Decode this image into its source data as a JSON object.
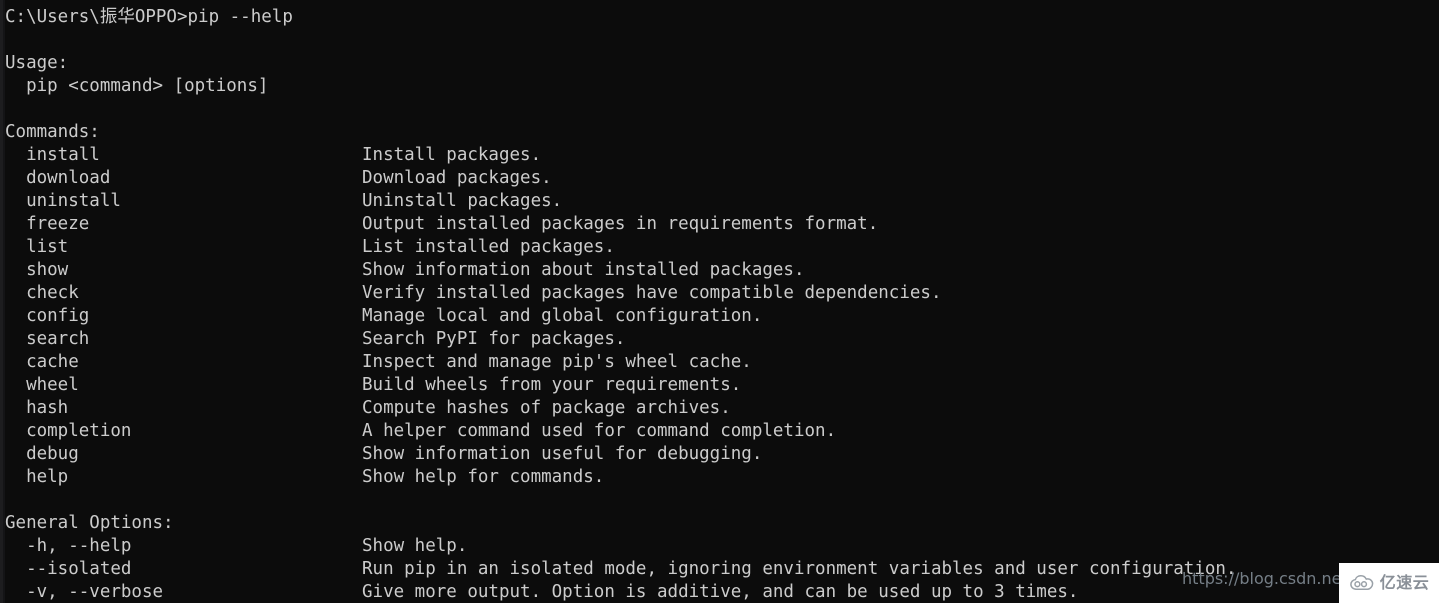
{
  "terminal": {
    "background_color": "#0c0c0c",
    "text_color": "#cccccc",
    "prompt_line": "C:\\Users\\振华OPPO>pip --help",
    "usage_header": "Usage:",
    "usage_line": "  pip <command> [options]",
    "commands_header": "Commands:",
    "commands": [
      {
        "name": "  install",
        "description": "Install packages."
      },
      {
        "name": "  download",
        "description": "Download packages."
      },
      {
        "name": "  uninstall",
        "description": "Uninstall packages."
      },
      {
        "name": "  freeze",
        "description": "Output installed packages in requirements format."
      },
      {
        "name": "  list",
        "description": "List installed packages."
      },
      {
        "name": "  show",
        "description": "Show information about installed packages."
      },
      {
        "name": "  check",
        "description": "Verify installed packages have compatible dependencies."
      },
      {
        "name": "  config",
        "description": "Manage local and global configuration."
      },
      {
        "name": "  search",
        "description": "Search PyPI for packages."
      },
      {
        "name": "  cache",
        "description": "Inspect and manage pip's wheel cache."
      },
      {
        "name": "  wheel",
        "description": "Build wheels from your requirements."
      },
      {
        "name": "  hash",
        "description": "Compute hashes of package archives."
      },
      {
        "name": "  completion",
        "description": "A helper command used for command completion."
      },
      {
        "name": "  debug",
        "description": "Show information useful for debugging."
      },
      {
        "name": "  help",
        "description": "Show help for commands."
      }
    ],
    "general_options_header": "General Options:",
    "general_options": [
      {
        "name": "  -h, --help",
        "description": "Show help."
      },
      {
        "name": "  --isolated",
        "description": "Run pip in an isolated mode, ignoring environment variables and user configuration."
      },
      {
        "name": "  -v, --verbose",
        "description": "Give more output. Option is additive, and can be used up to 3 times."
      }
    ]
  },
  "watermarks": {
    "csdn_url": "https://blog.csdn.net/q",
    "brand_name": "亿速云",
    "brand_icon": "cloud-icon",
    "brand_box_color": "#ffffff",
    "brand_text_color": "#8a9098"
  }
}
